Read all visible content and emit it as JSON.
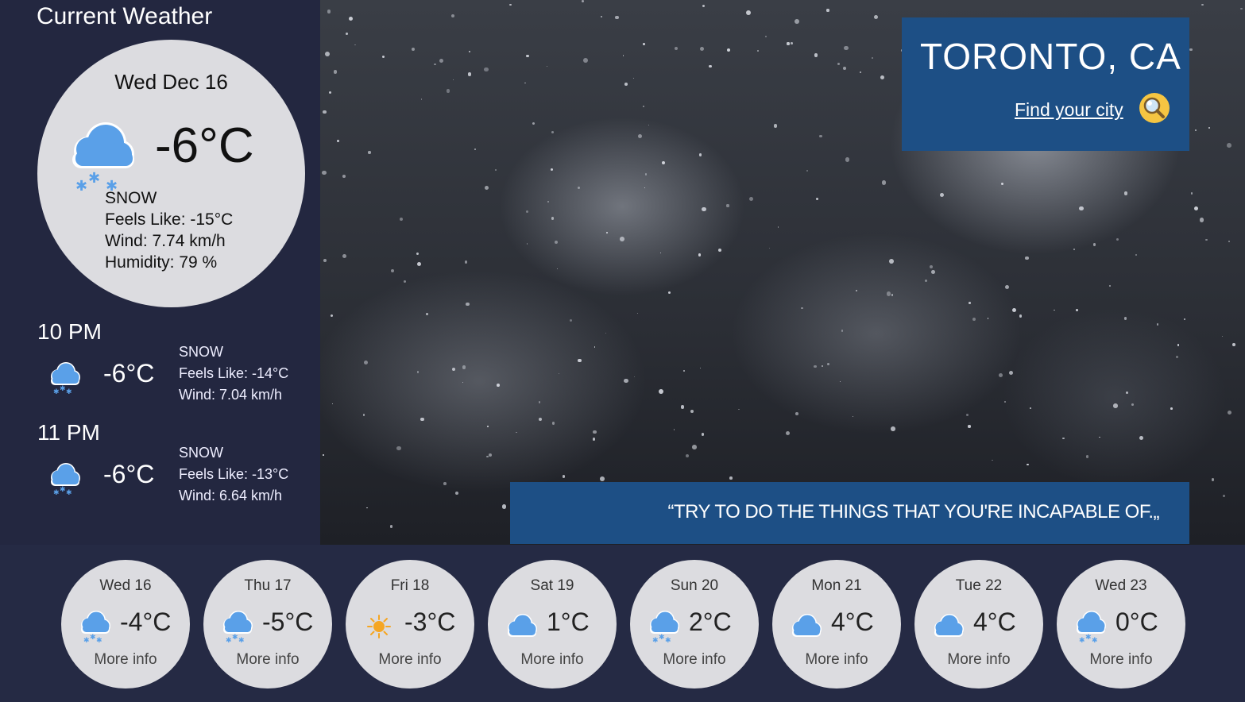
{
  "current": {
    "section_title": "Current Weather",
    "date": "Wed Dec 16",
    "temp": "-6°C",
    "condition": "SNOW",
    "feels_like": "Feels Like: -15°C",
    "wind": "Wind: 7.74 km/h",
    "humidity": "Humidity: 79 %",
    "icon": "snow-cloud-icon"
  },
  "hourly": [
    {
      "time": "10 PM",
      "temp": "-6°C",
      "condition": "SNOW",
      "feels_like": "Feels Like: -14°C",
      "wind": "Wind: 7.04 km/h",
      "icon": "snow-cloud-icon"
    },
    {
      "time": "11 PM",
      "temp": "-6°C",
      "condition": "SNOW",
      "feels_like": "Feels Like: -13°C",
      "wind": "Wind: 6.64 km/h",
      "icon": "snow-cloud-icon"
    }
  ],
  "location": {
    "city": "TORONTO, CA",
    "find_link": "Find your city",
    "search_icon": "magnifier-icon"
  },
  "quote": {
    "text": "“TRY TO DO THE THINGS THAT YOU'RE INCAPABLE OF.„"
  },
  "forecast": [
    {
      "day": "Wed 16",
      "temp": "-4°C",
      "icon": "snow-cloud-icon",
      "more": "More info"
    },
    {
      "day": "Thu 17",
      "temp": "-5°C",
      "icon": "snow-cloud-icon",
      "more": "More info"
    },
    {
      "day": "Fri 18",
      "temp": "-3°C",
      "icon": "sun-icon",
      "more": "More info"
    },
    {
      "day": "Sat 19",
      "temp": "1°C",
      "icon": "cloud-icon",
      "more": "More info"
    },
    {
      "day": "Sun 20",
      "temp": "2°C",
      "icon": "snow-cloud-icon",
      "more": "More info"
    },
    {
      "day": "Mon 21",
      "temp": "4°C",
      "icon": "cloud-icon",
      "more": "More info"
    },
    {
      "day": "Tue 22",
      "temp": "4°C",
      "icon": "cloud-icon",
      "more": "More info"
    },
    {
      "day": "Wed 23",
      "temp": "0°C",
      "icon": "snow-cloud-icon",
      "more": "More info"
    }
  ],
  "colors": {
    "background": "#232740",
    "panel_blue": "#1d4f85",
    "circle_bg": "#dcdce0",
    "icon_blue": "#5aa0e8"
  }
}
